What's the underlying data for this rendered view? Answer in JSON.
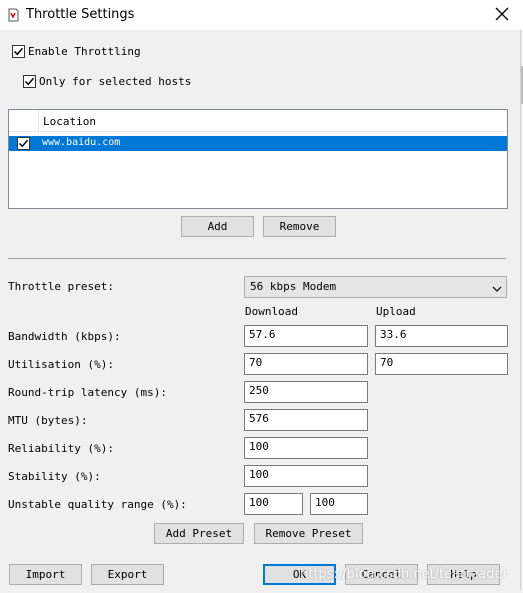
{
  "window": {
    "title": "Throttle Settings"
  },
  "options": {
    "enable_throttling": {
      "label": "Enable Throttling",
      "checked": true
    },
    "only_selected_hosts": {
      "label": "Only for selected hosts",
      "checked": true
    }
  },
  "hosts": {
    "column_header": "Location",
    "rows": [
      {
        "location": "www.baidu.com",
        "checked": true,
        "selected": true
      }
    ],
    "add_label": "Add",
    "remove_label": "Remove"
  },
  "preset": {
    "label": "Throttle preset:",
    "value": "56 kbps Modem"
  },
  "columns": {
    "download": "Download",
    "upload": "Upload"
  },
  "fields": {
    "bandwidth": {
      "label": "Bandwidth (kbps):",
      "download": "57.6",
      "upload": "33.6"
    },
    "utilisation": {
      "label": "Utilisation (%):",
      "download": "70",
      "upload": "70"
    },
    "latency": {
      "label": "Round-trip latency (ms):",
      "value": "250"
    },
    "mtu": {
      "label": "MTU (bytes):",
      "value": "576"
    },
    "reliability": {
      "label": "Reliability (%):",
      "value": "100"
    },
    "stability": {
      "label": "Stability (%):",
      "value": "100"
    },
    "unstable_range": {
      "label": "Unstable quality range (%):",
      "min": "100",
      "max": "100"
    }
  },
  "preset_buttons": {
    "add": "Add Preset",
    "remove": "Remove Preset"
  },
  "footer": {
    "import": "Import",
    "export": "Export",
    "ok": "OK",
    "cancel": "Cancel",
    "help": "Help"
  },
  "watermark": "https://blog.csdn.net/teatreader",
  "colors": {
    "selection": "#0078d7",
    "dialog_bg": "#f0f0f0",
    "button_bg": "#e1e1e1"
  }
}
